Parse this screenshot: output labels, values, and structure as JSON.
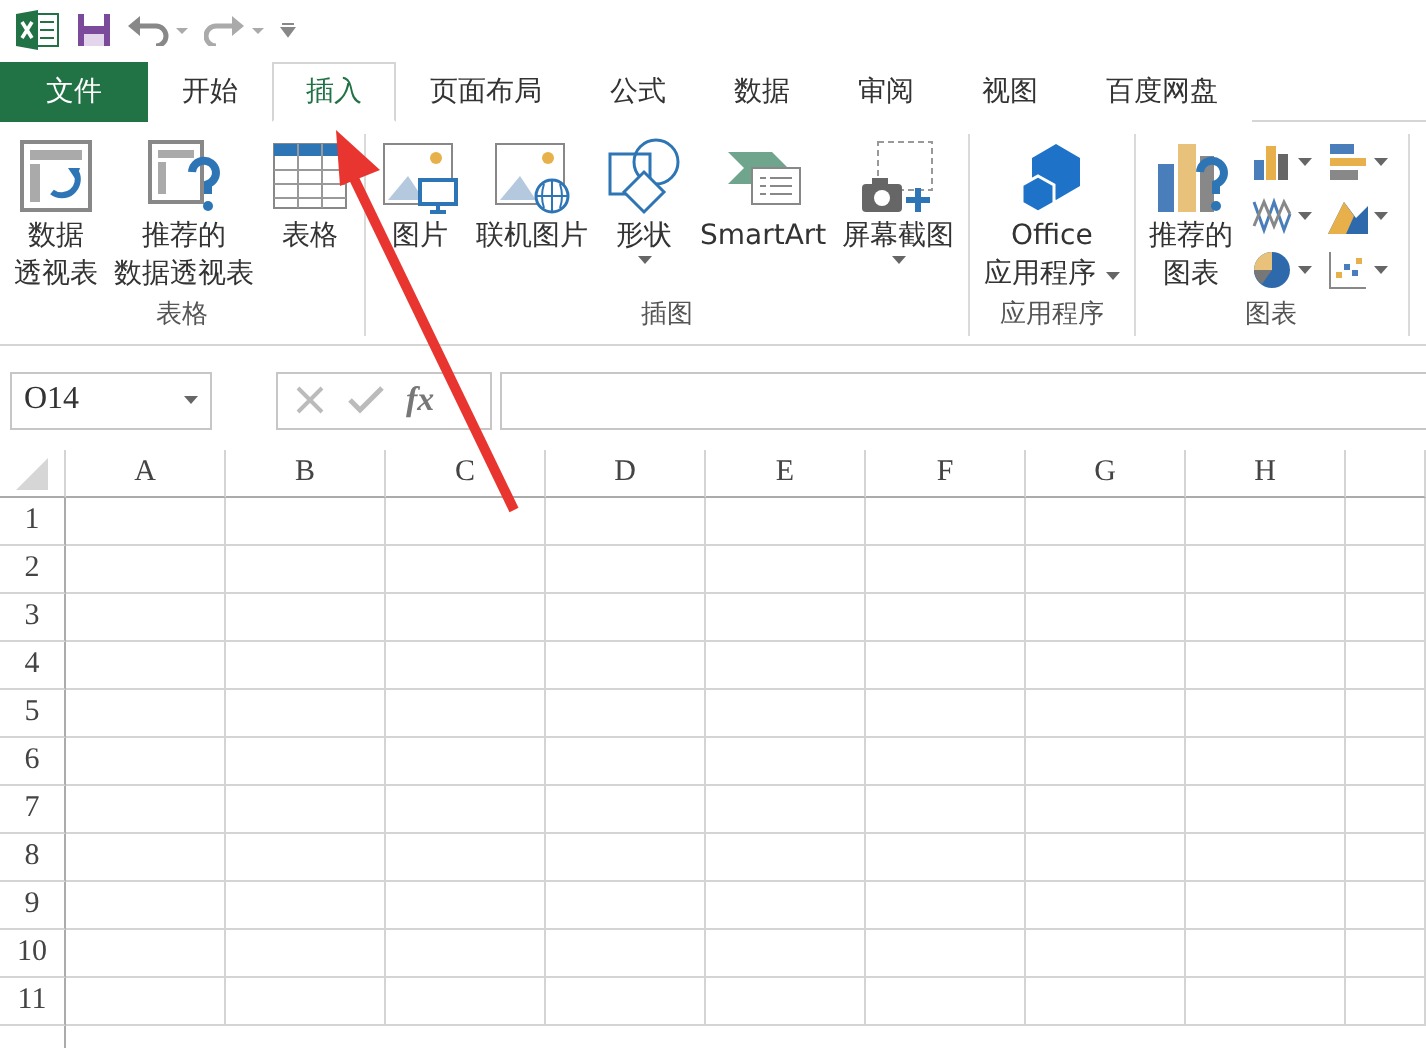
{
  "tabs": [
    {
      "label": "文件",
      "kind": "file",
      "selected": false
    },
    {
      "label": "开始",
      "kind": "tab",
      "selected": false
    },
    {
      "label": "插入",
      "kind": "tab",
      "selected": true
    },
    {
      "label": "页面布局",
      "kind": "tab",
      "selected": false
    },
    {
      "label": "公式",
      "kind": "tab",
      "selected": false
    },
    {
      "label": "数据",
      "kind": "tab",
      "selected": false
    },
    {
      "label": "审阅",
      "kind": "tab",
      "selected": false
    },
    {
      "label": "视图",
      "kind": "tab",
      "selected": false
    },
    {
      "label": "百度网盘",
      "kind": "tab",
      "selected": false
    }
  ],
  "ribbon_groups": [
    {
      "label": "表格",
      "commands": [
        {
          "lines": [
            "数据",
            "透视表"
          ],
          "dropdown": false
        },
        {
          "lines": [
            "推荐的",
            "数据透视表"
          ],
          "dropdown": false
        },
        {
          "lines": [
            "表格"
          ],
          "dropdown": false
        }
      ]
    },
    {
      "label": "插图",
      "commands": [
        {
          "lines": [
            "图片"
          ],
          "dropdown": false
        },
        {
          "lines": [
            "联机图片"
          ],
          "dropdown": false
        },
        {
          "lines": [
            "形状"
          ],
          "dropdown": true
        },
        {
          "lines": [
            "SmartArt"
          ],
          "dropdown": false
        },
        {
          "lines": [
            "屏幕截图"
          ],
          "dropdown": true
        }
      ]
    },
    {
      "label": "应用程序",
      "commands": [
        {
          "lines": [
            "Office",
            "应用程序"
          ],
          "dropdown": true
        }
      ]
    },
    {
      "label": "图表",
      "commands": [
        {
          "lines": [
            "推荐的",
            "图表"
          ],
          "dropdown": false
        }
      ]
    }
  ],
  "name_box": "O14",
  "function_label": "fx",
  "columns": [
    "A",
    "B",
    "C",
    "D",
    "E",
    "F",
    "G",
    "H"
  ],
  "rows": [
    "1",
    "2",
    "3",
    "4",
    "5",
    "6",
    "7",
    "8",
    "9",
    "10",
    "11"
  ]
}
